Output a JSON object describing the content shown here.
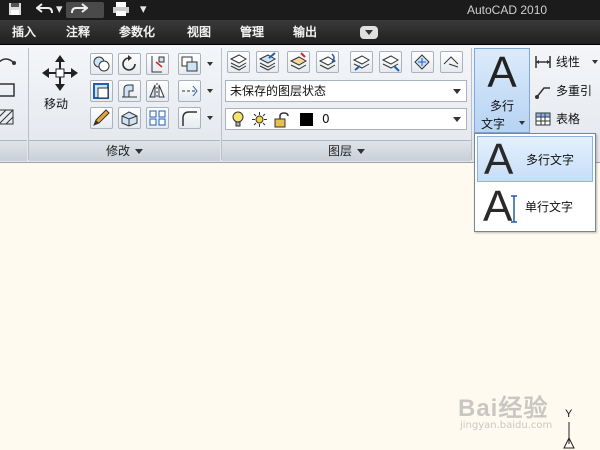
{
  "app": {
    "title": "AutoCAD 2010"
  },
  "menu": {
    "tabs": [
      {
        "label": "插入"
      },
      {
        "label": "注释"
      },
      {
        "label": "参数化"
      },
      {
        "label": "视图"
      },
      {
        "label": "管理"
      },
      {
        "label": "输出"
      }
    ]
  },
  "ribbon": {
    "modify": {
      "title": "修改",
      "move_label": "移动"
    },
    "layers": {
      "title": "图层",
      "layer_state": "未保存的图层状态",
      "current_layer": "0",
      "current_layer_color": "#000000"
    },
    "annotation": {
      "text_button_glyph": "A",
      "text_button_line1": "多行",
      "text_button_line2": "文字",
      "linear_label": "线性",
      "multileader_label": "多重引",
      "table_label": "表格"
    }
  },
  "dropdown": {
    "items": [
      {
        "glyph": "A",
        "label": "多行文字"
      },
      {
        "glyph": "A",
        "label": "单行文字"
      }
    ]
  },
  "watermark": {
    "text": "Bai经验",
    "url": "jingyan.baidu.com"
  },
  "ucs": {
    "y_label": "Y"
  },
  "colors": {
    "accent": "#b6d3f3",
    "canvas": "#fefaf0",
    "titlebar": "#1b1b1b"
  }
}
